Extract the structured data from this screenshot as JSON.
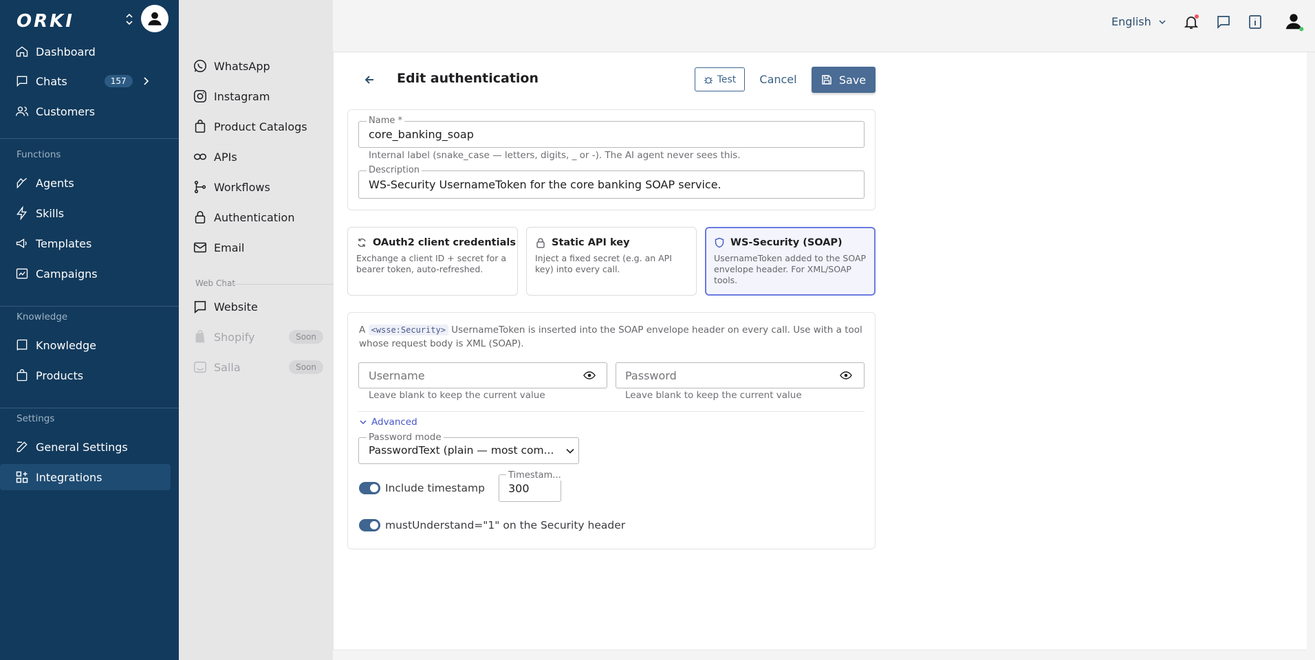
{
  "brand": {
    "logo": "ORKI"
  },
  "sidebar": {
    "items": [
      {
        "label": "Dashboard"
      },
      {
        "label": "Chats",
        "badge": "157"
      },
      {
        "label": "Customers"
      },
      {
        "label": "Agents"
      },
      {
        "label": "Skills"
      },
      {
        "label": "Templates"
      },
      {
        "label": "Campaigns"
      },
      {
        "label": "Knowledge"
      },
      {
        "label": "Products"
      },
      {
        "label": "General Settings"
      },
      {
        "label": "Integrations"
      }
    ],
    "sections": {
      "functions": "Functions",
      "knowledge": "Knowledge",
      "settings": "Settings"
    }
  },
  "subnav": {
    "items": [
      {
        "label": "WhatsApp"
      },
      {
        "label": "Instagram"
      },
      {
        "label": "Product Catalogs"
      },
      {
        "label": "APIs"
      },
      {
        "label": "Workflows"
      },
      {
        "label": "Authentication"
      },
      {
        "label": "Email"
      }
    ],
    "webchat_label": "Web Chat",
    "webchat_items": [
      {
        "label": "Website"
      },
      {
        "label": "Shopify",
        "badge": "Soon"
      },
      {
        "label": "Salla",
        "badge": "Soon"
      }
    ]
  },
  "topbar": {
    "language": "English",
    "icons": [
      "bell-icon",
      "chat-icon",
      "info-icon",
      "user-icon"
    ]
  },
  "page": {
    "title": "Edit authentication",
    "test_label": "Test",
    "cancel_label": "Cancel",
    "save_label": "Save"
  },
  "form": {
    "name_label": "Name *",
    "name_value": "core_banking_soap",
    "name_help": "Internal label (snake_case — letters, digits, _ or -). The AI agent never sees this.",
    "description_label": "Description",
    "description_value": "WS-Security UsernameToken for the core banking SOAP service."
  },
  "auth_types": [
    {
      "title": "OAuth2 client credentials",
      "desc": "Exchange a client ID + secret for a bearer token, auto-refreshed."
    },
    {
      "title": "Static API key",
      "desc": "Inject a fixed secret (e.g. an API key) into every call."
    },
    {
      "title": "WS-Security (SOAP)",
      "desc": "UsernameToken added to the SOAP envelope header. For XML/SOAP tools.",
      "selected": true
    }
  ],
  "ws": {
    "intro_prefix": "A",
    "intro_code": "<wsse:Security>",
    "intro_rest": "UsernameToken is inserted into the SOAP envelope header on every call. Use with a tool whose request body is XML (SOAP).",
    "username_placeholder": "Username",
    "password_placeholder": "Password",
    "keep_help": "Leave blank to keep the current value",
    "advanced_label": "Advanced",
    "password_mode_label": "Password mode",
    "password_mode_value": "PasswordText (plain — most com...",
    "include_timestamp_label": "Include timestamp",
    "include_timestamp": true,
    "timestamp_label": "Timestam...",
    "timestamp_value": "300",
    "must_understand_label": "mustUnderstand=\"1\" on the Security header",
    "must_understand": true
  }
}
